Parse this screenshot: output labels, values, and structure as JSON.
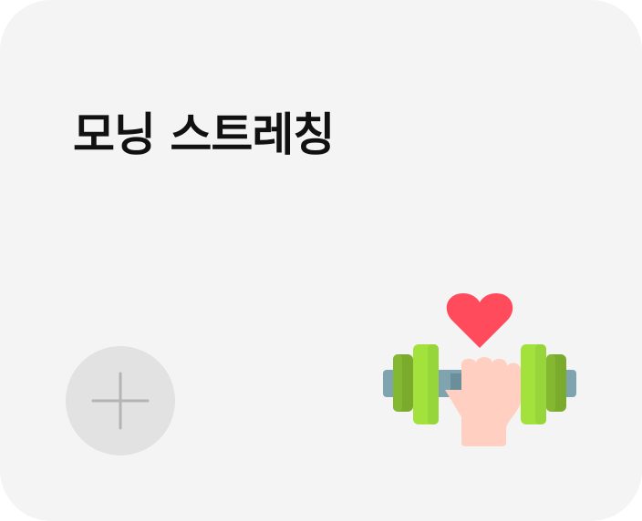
{
  "card": {
    "title": "모닝 스트레칭",
    "add_button_icon": "plus-icon",
    "illustration_icon": "dumbbell-heart-icon",
    "colors": {
      "background": "#f4f4f4",
      "add_button": "#e2e2e2",
      "heart": "#ff4b5c",
      "plate_light": "#a3e23c",
      "plate_dark": "#7aab2c",
      "bar": "#7fa4b0",
      "hand": "#ffd0c2"
    }
  }
}
